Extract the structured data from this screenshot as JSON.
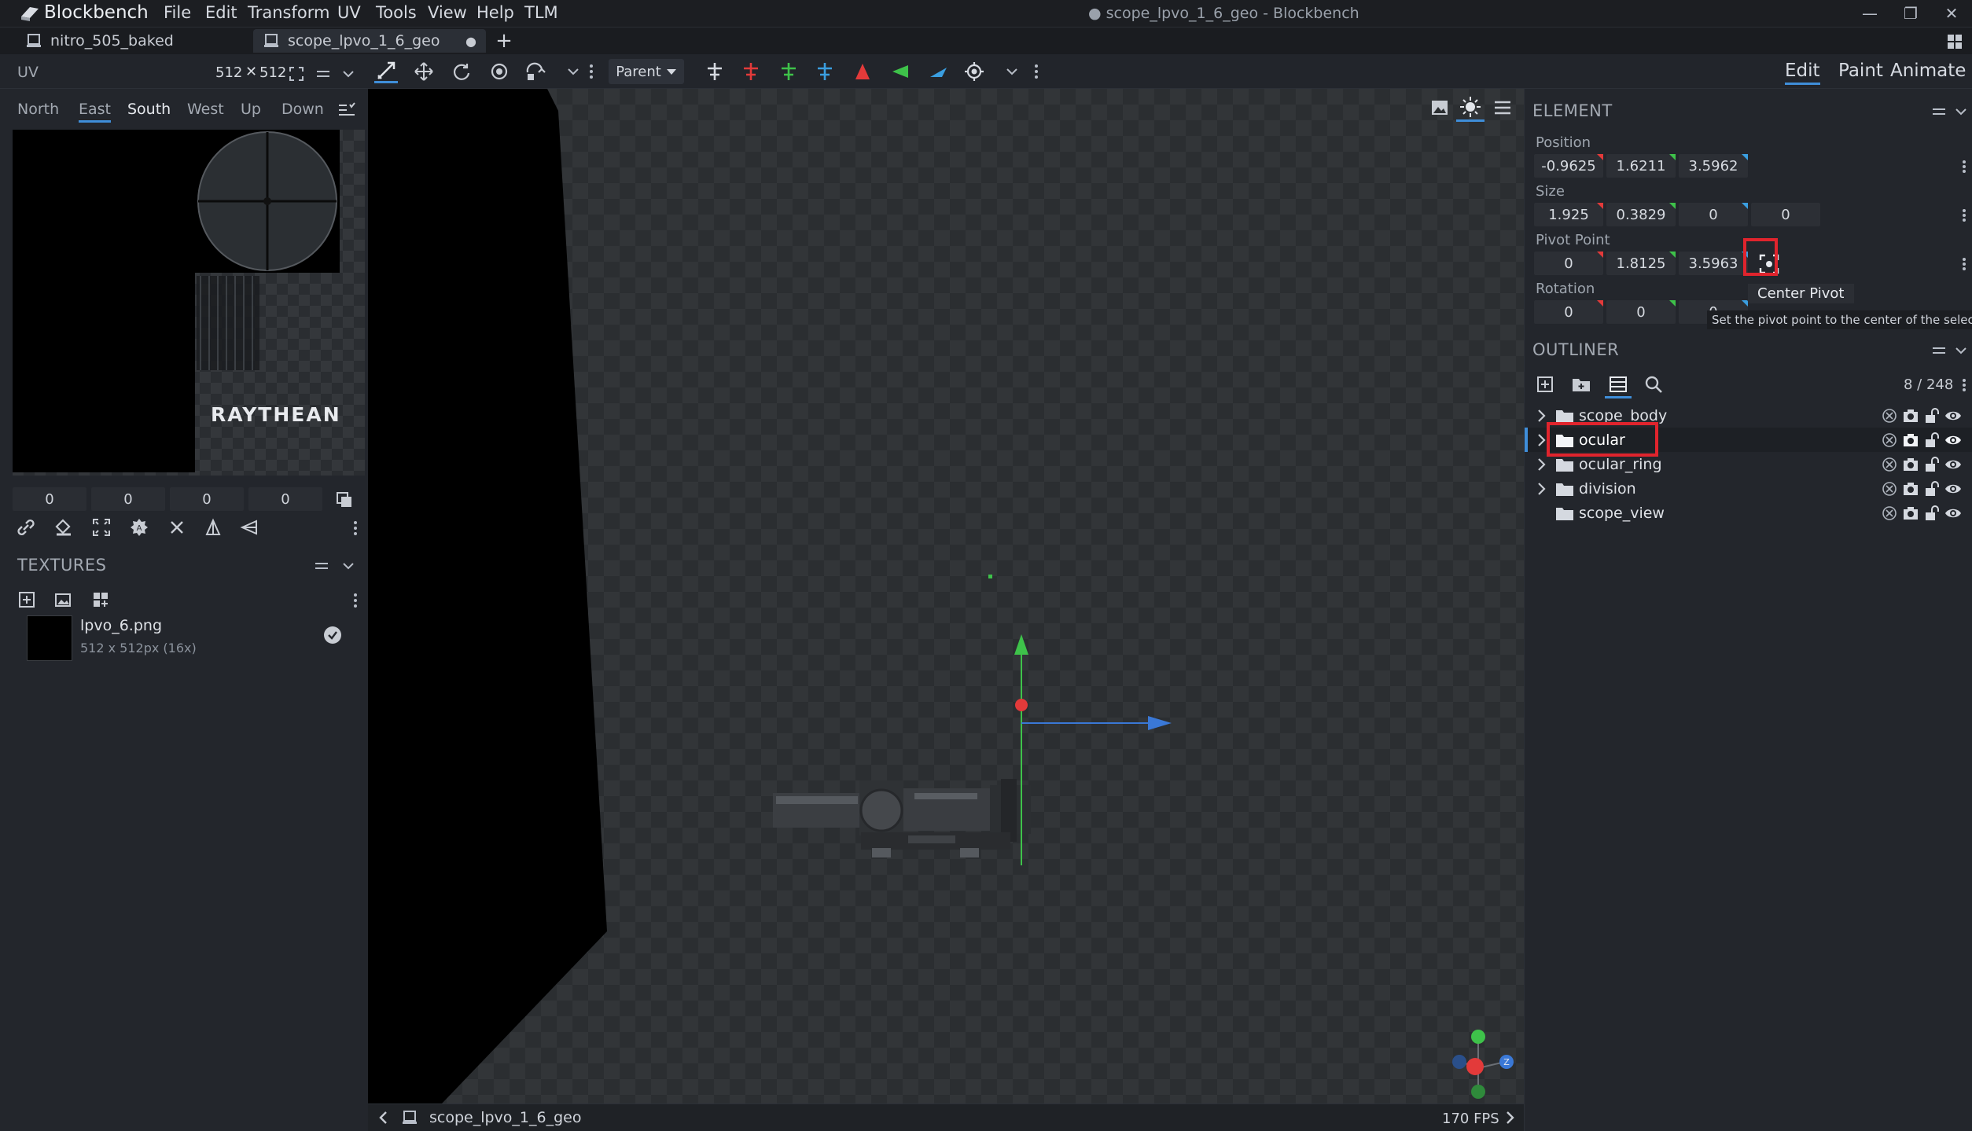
{
  "app": {
    "name": "Blockbench",
    "menu": [
      "File",
      "Edit",
      "Transform",
      "UV",
      "Tools",
      "View",
      "Help",
      "TLM"
    ],
    "window_title": "● scope_lpvo_1_6_geo - Blockbench"
  },
  "tabs": [
    {
      "label": "nitro_505_baked"
    },
    {
      "label": "scope_lpvo_1_6_geo",
      "modified": "●"
    }
  ],
  "toolbar": {
    "parent_label": "Parent",
    "modes": [
      "Edit",
      "Paint",
      "Animate"
    ]
  },
  "uv": {
    "title": "UV",
    "size_w": "512",
    "size_x": "✕",
    "size_h": "512",
    "faces": [
      "North",
      "East",
      "South",
      "West",
      "Up",
      "Down"
    ],
    "selected_face": "South",
    "values": [
      "0",
      "0",
      "0",
      "0"
    ],
    "texture_logo": "RAYTHEAN"
  },
  "textures": {
    "title": "TEXTURES",
    "items": [
      {
        "name": "lpvo_6.png",
        "meta": "512 x 512px (16x)"
      }
    ]
  },
  "element": {
    "title": "ELEMENT",
    "position_label": "Position",
    "position": [
      "-0.9625",
      "1.6211",
      "3.5962"
    ],
    "size_label": "Size",
    "size": [
      "1.925",
      "0.3829",
      "0",
      "0"
    ],
    "pivot_label": "Pivot Point",
    "pivot": [
      "0",
      "1.8125",
      "3.5963"
    ],
    "rotation_label": "Rotation",
    "rotation": [
      "0",
      "0",
      "0"
    ]
  },
  "tooltip": {
    "title": "Center Pivot",
    "description": "Set the pivot point to the center of the selection"
  },
  "outliner": {
    "title": "OUTLINER",
    "count": "8 / 248",
    "items": [
      {
        "label": "scope_body",
        "has_children": true
      },
      {
        "label": "ocular",
        "has_children": true,
        "selected": true
      },
      {
        "label": "ocular_ring",
        "has_children": true
      },
      {
        "label": "division",
        "has_children": true
      },
      {
        "label": "scope_view",
        "has_children": false
      }
    ]
  },
  "viewport": {
    "model_name": "scope_lpvo_1_6_geo",
    "fps": "170 FPS"
  },
  "colors": {
    "accent": "#3f8ed9",
    "highlight": "#e0242d",
    "x_axis": "#e33a3a",
    "y_axis": "#3ec24a",
    "z_axis": "#3a78d6"
  }
}
